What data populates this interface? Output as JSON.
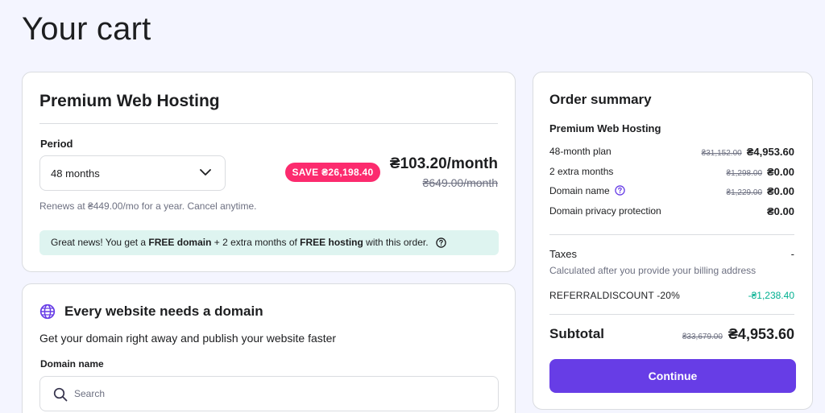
{
  "page": {
    "title": "Your cart"
  },
  "plan": {
    "title": "Premium Web Hosting",
    "period_label": "Period",
    "period_value": "48 months",
    "save_badge": "SAVE ₴26,198.40",
    "price": "₴103.20/month",
    "old_price": "₴649.00/month",
    "renews_text": "Renews at ₴449.00/mo for a year. Cancel anytime.",
    "promo": {
      "prefix": "Great news! You get a ",
      "bold1": "FREE domain",
      "mid": " + 2 extra months of ",
      "bold2": "FREE hosting",
      "suffix": " with this order."
    }
  },
  "domain": {
    "heading": "Every website needs a domain",
    "subheading": "Get your domain right away and publish your website faster",
    "field_label": "Domain name",
    "search_placeholder": "Search"
  },
  "summary": {
    "title": "Order summary",
    "product": "Premium Web Hosting",
    "items": [
      {
        "label": "48-month plan",
        "strike": "₴31,152.00",
        "amount": "₴4,953.60"
      },
      {
        "label": "2 extra months",
        "strike": "₴1,298.00",
        "amount": "₴0.00"
      },
      {
        "label": "Domain name",
        "strike": "₴1,229.00",
        "amount": "₴0.00"
      },
      {
        "label": "Domain privacy protection",
        "strike": "",
        "amount": "₴0.00"
      }
    ],
    "taxes_label": "Taxes",
    "taxes_value": "-",
    "taxes_note": "Calculated after you provide your billing address",
    "discount_label": "REFERRALDISCOUNT -20%",
    "discount_value": "-₴1,238.40",
    "subtotal_label": "Subtotal",
    "subtotal_strike": "₴33,679.00",
    "subtotal_amount": "₴4,953.60",
    "continue_label": "Continue"
  },
  "colors": {
    "accent": "#673de6",
    "save_badge": "#fc2b6e",
    "promo_bg": "#def4f0",
    "discount": "#00b090",
    "page_bg": "#f4f5ff"
  }
}
